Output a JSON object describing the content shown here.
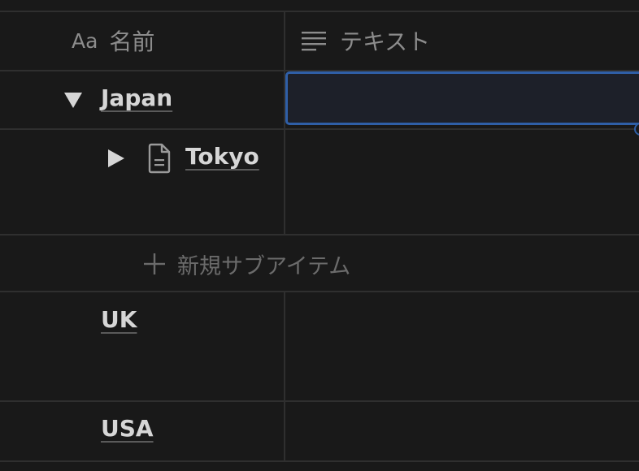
{
  "header": {
    "name_icon": "Aa",
    "name_label": "名前",
    "text_label": "テキスト"
  },
  "rows": [
    {
      "label": "Japan",
      "expanded": true,
      "text_value": ""
    },
    {
      "label": "Tokyo",
      "expanded": false,
      "icon": "page-icon",
      "text_value": ""
    },
    {
      "label": "UK",
      "text_value": ""
    },
    {
      "label": "USA",
      "text_value": ""
    }
  ],
  "new_subitem": {
    "label": "新規サブアイテム"
  },
  "colors": {
    "background": "#191919",
    "divider": "#2f2f2f",
    "selection": "#2f5fa7",
    "text": "#d6d6d6",
    "muted": "#8c8c8c"
  }
}
